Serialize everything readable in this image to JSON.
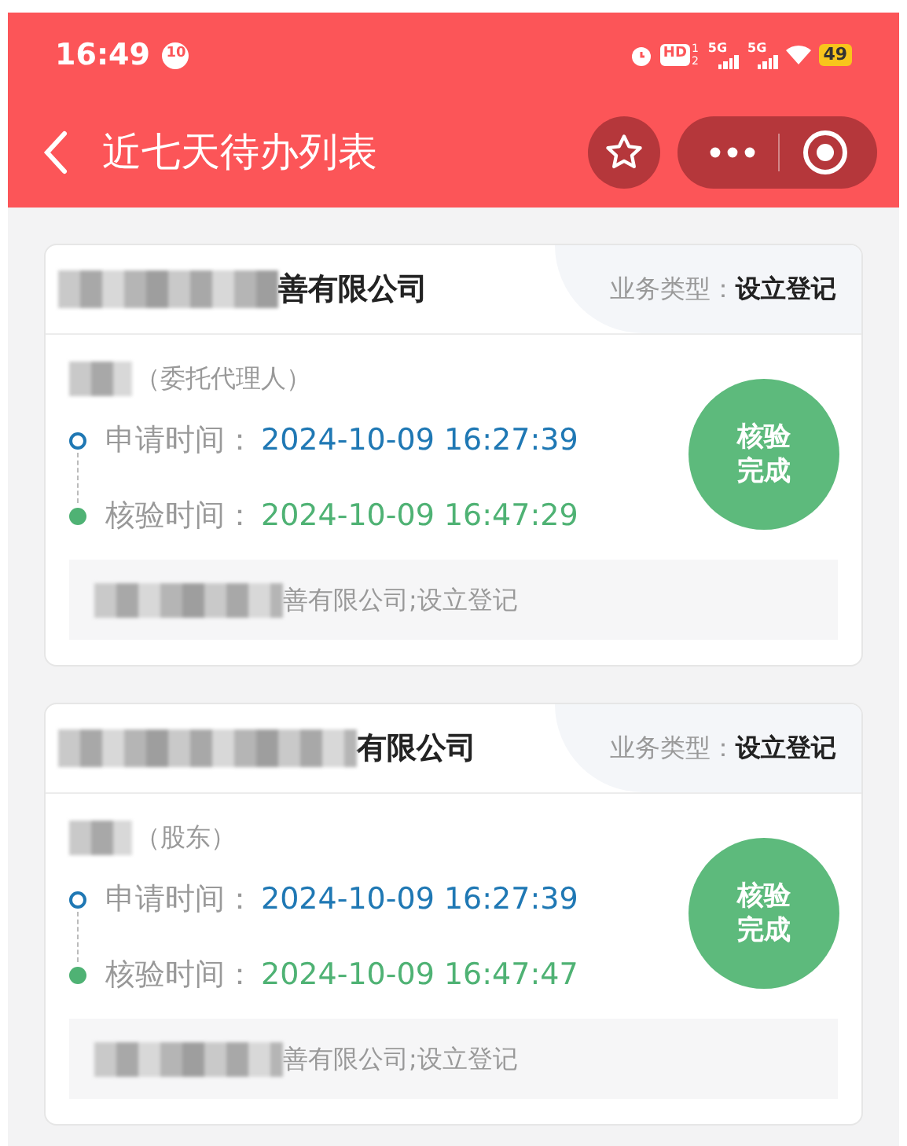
{
  "status_bar": {
    "time": "16:49",
    "notification_count": "10",
    "hd_label": "HD",
    "hd_sub": [
      "1",
      "2"
    ],
    "network_labels": [
      "5G",
      "5G"
    ],
    "battery": "49"
  },
  "nav": {
    "title": "近七天待办列表"
  },
  "cards": [
    {
      "company": "善有限公司",
      "business_type_label": "业务类型：",
      "business_type": "设立登记",
      "role": "（委托代理人）",
      "timeline": [
        {
          "kind": "apply",
          "label": "申请时间：",
          "time": "2024-10-09 16:27:39"
        },
        {
          "kind": "verify",
          "label": "核验时间：",
          "time": "2024-10-09 16:47:29"
        }
      ],
      "status": "核验完成",
      "summary": "善有限公司;设立登记"
    },
    {
      "company": "有限公司",
      "business_type_label": "业务类型：",
      "business_type": "设立登记",
      "role": "（股东）",
      "timeline": [
        {
          "kind": "apply",
          "label": "申请时间：",
          "time": "2024-10-09 16:27:39"
        },
        {
          "kind": "verify",
          "label": "核验时间：",
          "time": "2024-10-09 16:47:47"
        }
      ],
      "status": "核验完成",
      "summary": "善有限公司;设立登记"
    }
  ]
}
